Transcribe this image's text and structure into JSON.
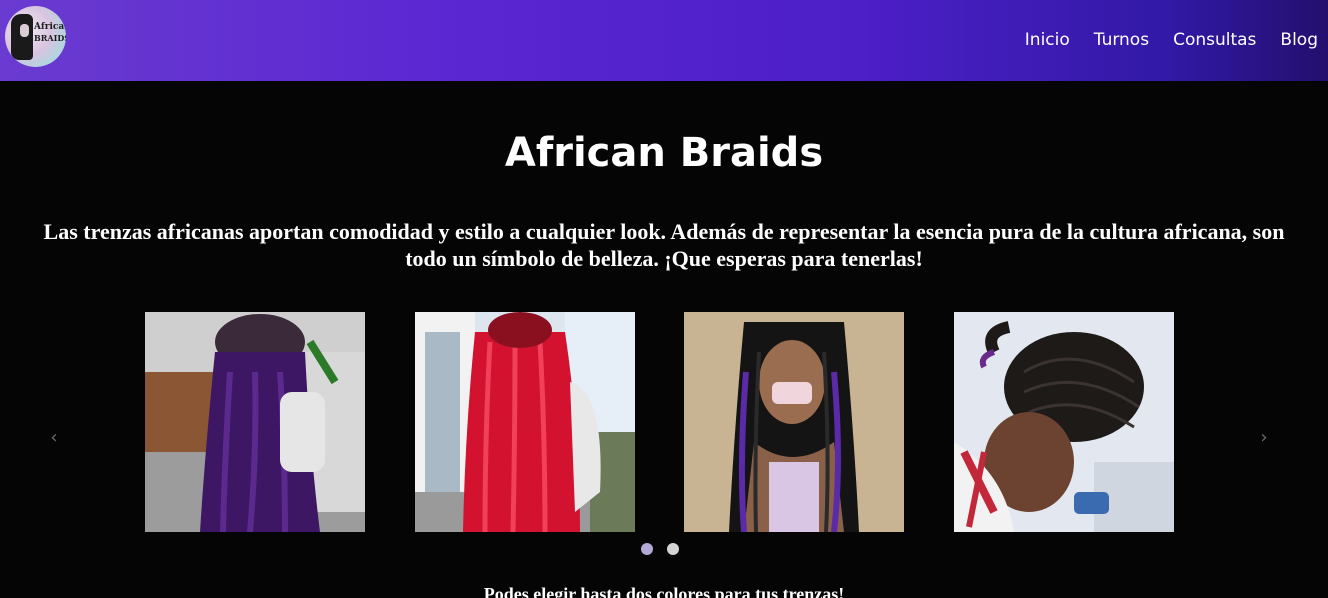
{
  "navbar": {
    "logo": {
      "line1": "African",
      "line2": "BRAIDS"
    },
    "links": [
      "Inicio",
      "Turnos",
      "Consultas",
      "Blog"
    ]
  },
  "hero": {
    "title": "African Braids",
    "intro": "Las trenzas africanas aportan comodidad y estilo a cualquier look. Además de representar la esencia pura de la cultura africana, son todo un símbolo de belleza. ¡Que esperas para tenerlas!"
  },
  "carousel": {
    "prev_icon": "‹",
    "next_icon": "›",
    "slides": [
      {
        "icon": "purple-braids-photo"
      },
      {
        "icon": "red-braids-photo"
      },
      {
        "icon": "black-purple-braids-photo"
      },
      {
        "icon": "cornrow-braids-photo"
      }
    ],
    "dots": {
      "total": 2,
      "active_index": 0
    }
  },
  "bottom_text": "Podes elegir hasta dos colores para tus trenzas!"
}
